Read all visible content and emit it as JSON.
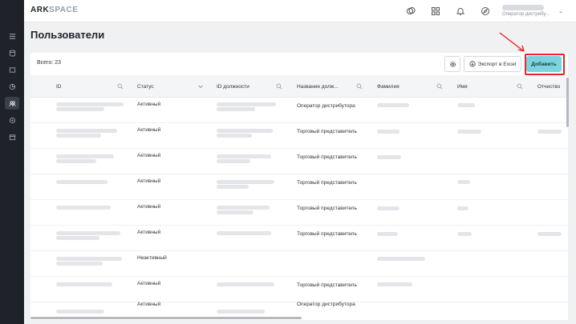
{
  "app": {
    "logo_main": "ARK",
    "logo_accent": "SPACE"
  },
  "user": {
    "role": "Оператор дистрибу..."
  },
  "page": {
    "title": "Пользователи"
  },
  "toolbar": {
    "total": "Всего: 23",
    "export_label": "Экспорт в Excel",
    "add_label": "Добавить"
  },
  "table": {
    "columns": [
      "ID",
      "Статус",
      "ID должности",
      "Название долж...",
      "Фамилия",
      "Имя",
      "Отчество"
    ],
    "rows": [
      {
        "status": "Активный",
        "position": "Оператор дистрибутора"
      },
      {
        "status": "Активный",
        "position": "Торговый представитель"
      },
      {
        "status": "Активный",
        "position": "Торговый представитель"
      },
      {
        "status": "Активный",
        "position": "Торговый представитель"
      },
      {
        "status": "Активный",
        "position": "Торговый представитель"
      },
      {
        "status": "Активный",
        "position": "Торговый представитель"
      },
      {
        "status": "Неактивный",
        "position": ""
      },
      {
        "status": "Активный",
        "position": "Торговый представитель"
      },
      {
        "status": "Активный",
        "position": "Оператор дистрибутора"
      }
    ]
  },
  "icons": {
    "sidebar": [
      "list-icon",
      "database-icon",
      "box-icon",
      "chart-icon",
      "users-icon",
      "target-icon",
      "calendar-icon"
    ],
    "topbar": [
      "currency-icon",
      "apps-grid-icon",
      "bell-icon",
      "compass-icon"
    ]
  },
  "colors": {
    "accent": "#7bd3df",
    "sidebar": "#1f2329",
    "highlight": "#e8242a"
  }
}
